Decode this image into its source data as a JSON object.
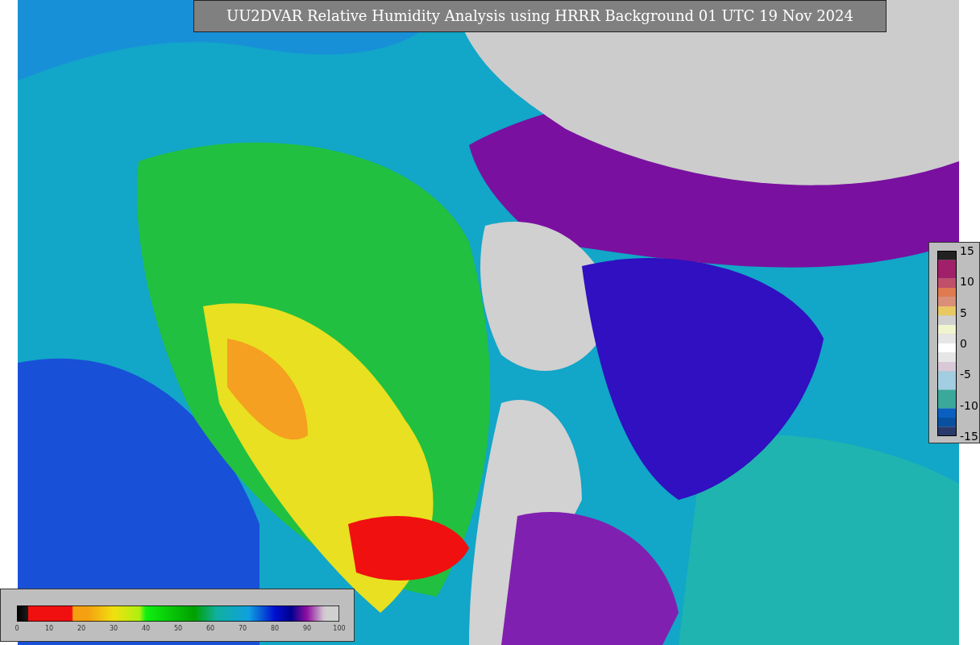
{
  "title": "UU2DVAR Relative Humidity Analysis using HRRR Background 01 UTC 19 Nov 2024",
  "anomaly_scale": {
    "ticks": [
      "15",
      "10",
      "5",
      "0",
      "-5",
      "-10",
      "-15"
    ]
  },
  "humidity_scale": {
    "ticks": [
      "0",
      "10",
      "20",
      "30",
      "40",
      "50",
      "60",
      "70",
      "80",
      "90",
      "100"
    ]
  }
}
